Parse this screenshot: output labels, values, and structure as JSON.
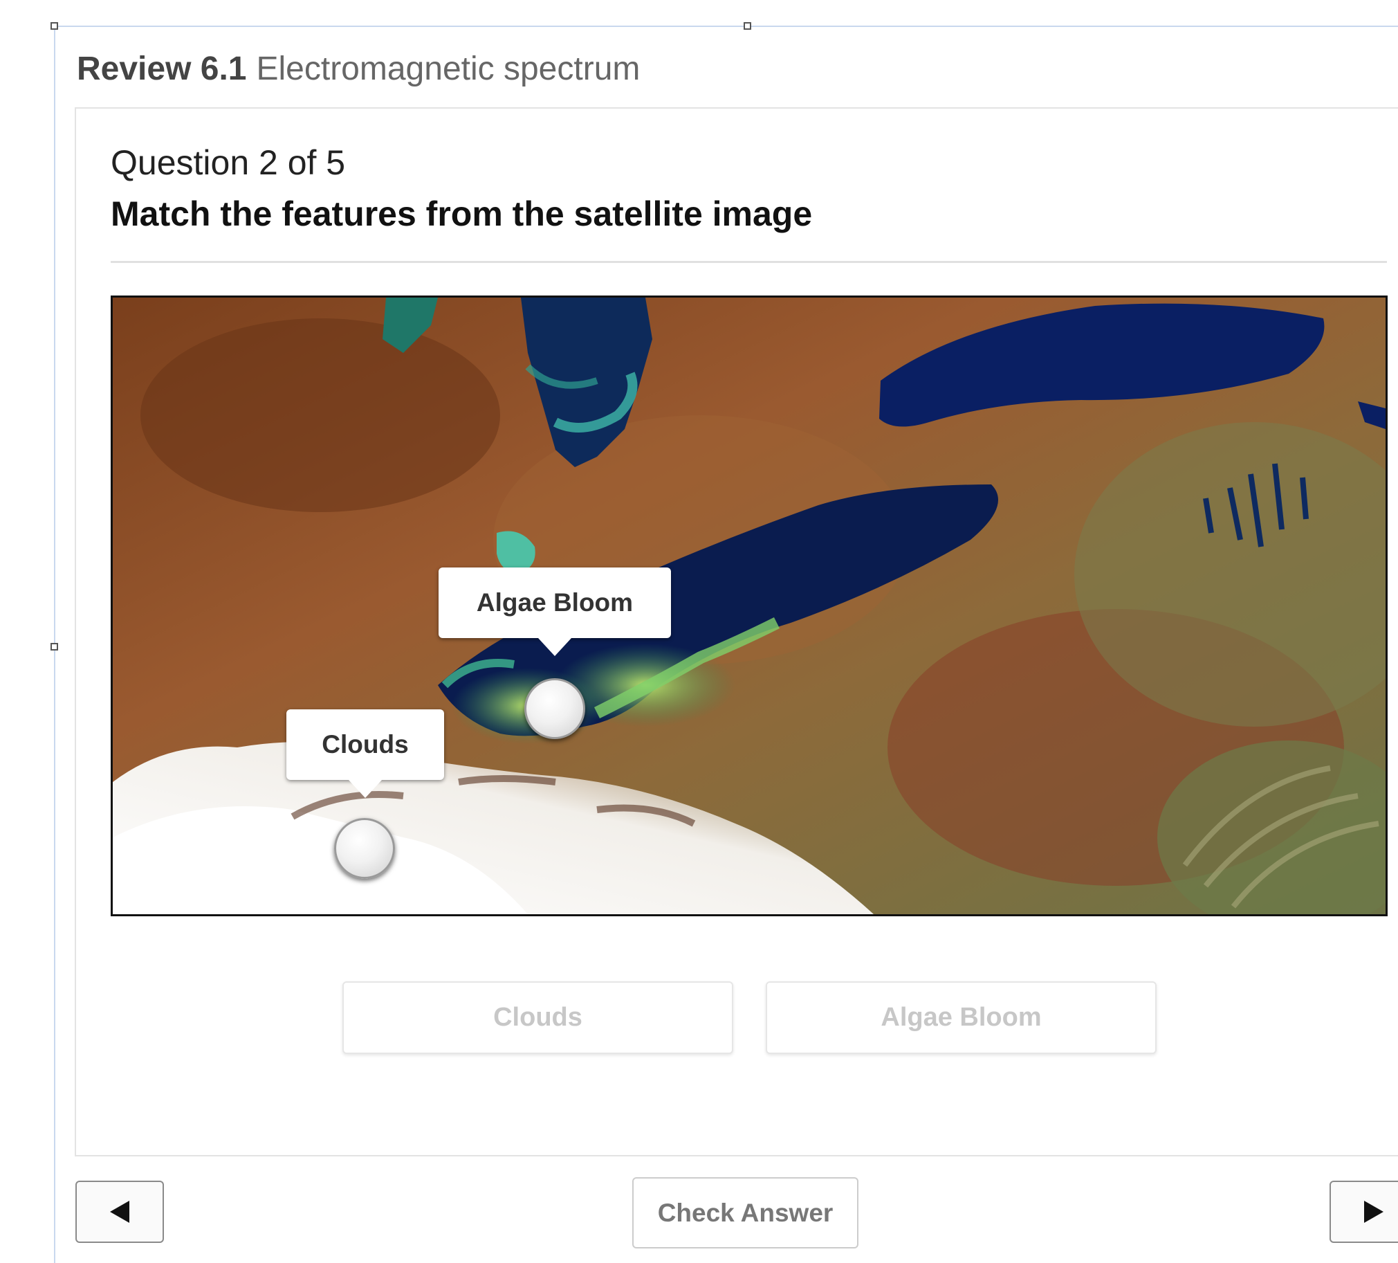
{
  "header": {
    "review_label": "Review 6.1",
    "review_topic": "Electromagnetic spectrum"
  },
  "question": {
    "counter": "Question 2 of 5",
    "title": "Match the features from the satellite image"
  },
  "image": {
    "pins": [
      {
        "label": "Algae Bloom"
      },
      {
        "label": "Clouds"
      }
    ]
  },
  "answers": [
    "Clouds",
    "Algae Bloom"
  ],
  "footer": {
    "check_label": "Check Answer",
    "prev_icon": "triangle-left-icon",
    "next_icon": "triangle-right-icon"
  }
}
